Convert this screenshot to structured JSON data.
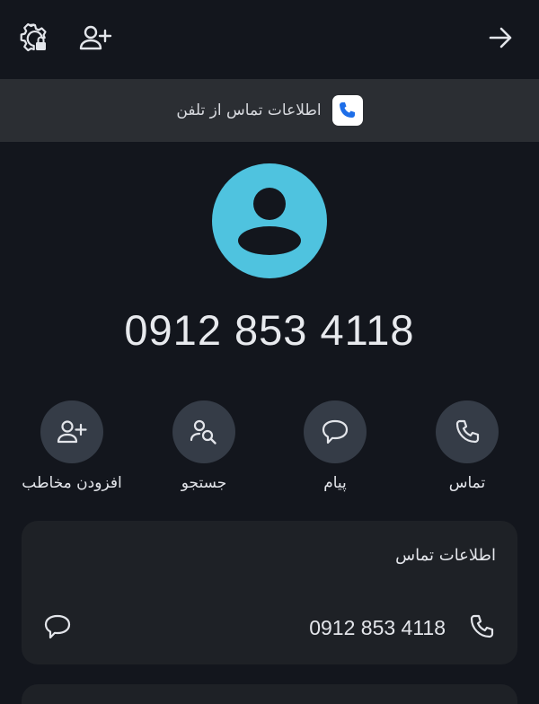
{
  "banner": {
    "text": "اطلاعات تماس از تلفن",
    "app_icon": "phone-app-icon"
  },
  "contact": {
    "phone_number": "0912 853 4118",
    "avatar_color": "#4fc3df"
  },
  "actions": [
    {
      "label": "افزودن مخاطب",
      "icon": "add-contact-icon"
    },
    {
      "label": "جستجو",
      "icon": "search-person-icon"
    },
    {
      "label": "پیام",
      "icon": "message-icon"
    },
    {
      "label": "تماس",
      "icon": "call-icon"
    }
  ],
  "info_card": {
    "title": "اطلاعات تماس",
    "phone": "0912 853 4118"
  },
  "topbar": {
    "icons": [
      "settings-lock-icon",
      "add-person-icon",
      "arrow-right-icon"
    ]
  }
}
